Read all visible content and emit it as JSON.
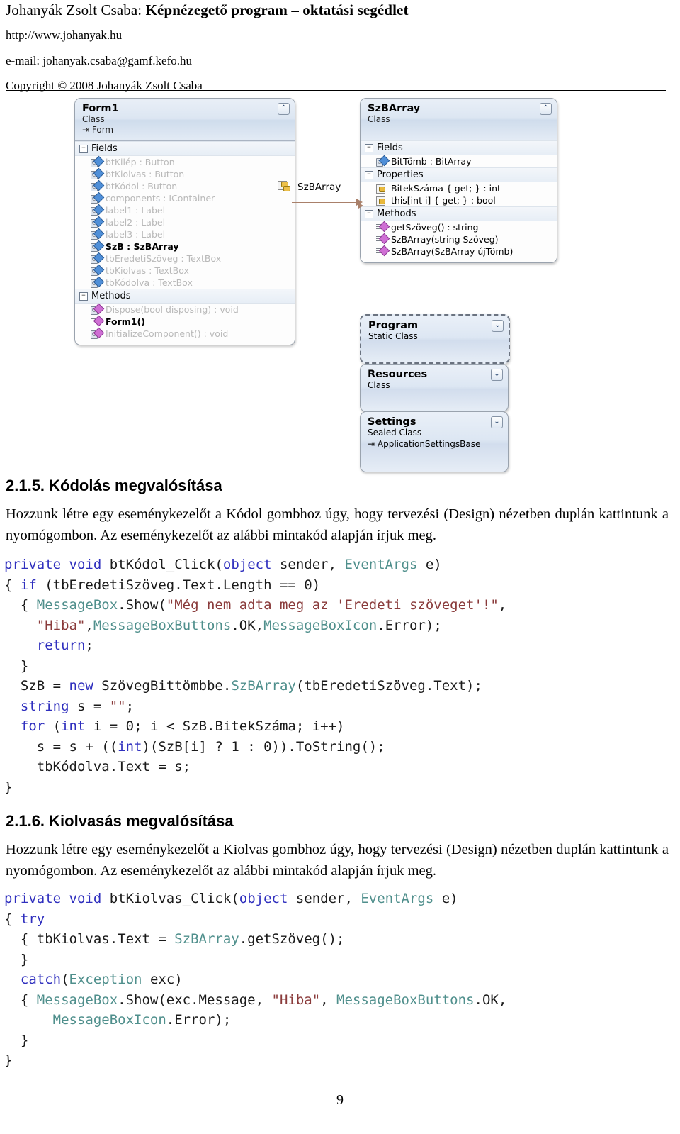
{
  "header": {
    "title_author": "Johanyák Zsolt Csaba: ",
    "title_main": "Képnézegető program – oktatási segédlet",
    "url": "http://www.johanyak.hu",
    "email": "e-mail: johanyak.csaba@gamf.kefo.hu",
    "copyright": "Copyright © 2008 Johanyák Zsolt Csaba"
  },
  "diagram": {
    "form1": {
      "name": "Form1",
      "kind": "Class",
      "base": "Form",
      "groups": [
        {
          "label": "Fields",
          "members": [
            {
              "text": "btKilép : Button",
              "icon": "field-icon",
              "style": "dim"
            },
            {
              "text": "btKiolvas : Button",
              "icon": "field-icon",
              "style": "dim"
            },
            {
              "text": "btKódol : Button",
              "icon": "field-icon",
              "style": "dim"
            },
            {
              "text": "components : IContainer",
              "icon": "field-icon",
              "style": "dim"
            },
            {
              "text": "label1 : Label",
              "icon": "field-icon",
              "style": "dim"
            },
            {
              "text": "label2 : Label",
              "icon": "field-icon",
              "style": "dim"
            },
            {
              "text": "label3 : Label",
              "icon": "field-icon",
              "style": "dim"
            },
            {
              "text": "SzB : SzBArray",
              "icon": "field-icon",
              "style": "strong"
            },
            {
              "text": "tbEredetiSzöveg : TextBox",
              "icon": "field-icon",
              "style": "dim"
            },
            {
              "text": "tbKiolvas : TextBox",
              "icon": "field-icon",
              "style": "dim"
            },
            {
              "text": "tbKódolva : TextBox",
              "icon": "field-icon",
              "style": "dim"
            }
          ]
        },
        {
          "label": "Methods",
          "members": [
            {
              "text": "Dispose(bool disposing) : void",
              "icon": "method-icon",
              "style": "dim"
            },
            {
              "text": "Form1()",
              "icon": "method-public-icon",
              "style": "strong"
            },
            {
              "text": "InitializeComponent() : void",
              "icon": "method-icon",
              "style": "dim"
            }
          ]
        }
      ]
    },
    "szbarray": {
      "name": "SzBArray",
      "kind": "Class",
      "groups": [
        {
          "label": "Fields",
          "members": [
            {
              "text": "BitTömb : BitArray",
              "icon": "field-icon",
              "style": "normal"
            }
          ]
        },
        {
          "label": "Properties",
          "members": [
            {
              "text": "BitekSzáma { get; } : int",
              "icon": "property-icon",
              "style": "normal"
            },
            {
              "text": "this[int i] { get; } : bool",
              "icon": "property-icon",
              "style": "normal"
            }
          ]
        },
        {
          "label": "Methods",
          "members": [
            {
              "text": "getSzöveg() : string",
              "icon": "method-public-icon",
              "style": "normal"
            },
            {
              "text": "SzBArray(string Szöveg)",
              "icon": "method-public-icon",
              "style": "normal"
            },
            {
              "text": "SzBArray(SzBArray újTömb)",
              "icon": "method-public-icon",
              "style": "normal"
            }
          ]
        }
      ]
    },
    "association_label": "SzBArray",
    "small_boxes": [
      {
        "name": "Program",
        "kind": "Static Class",
        "base": "",
        "dashed": true
      },
      {
        "name": "Resources",
        "kind": "Class",
        "base": "",
        "dashed": false
      },
      {
        "name": "Settings",
        "kind": "Sealed Class",
        "base": "ApplicationSettingsBase",
        "dashed": false
      }
    ],
    "collapse_glyph": "«",
    "expand_glyph": "»",
    "minus_glyph": "−"
  },
  "sections": [
    {
      "heading": "2.1.5. Kódolás megvalósítása",
      "paragraph": "Hozzunk létre egy eseménykezelőt a Kódol gombhoz úgy, hogy tervezési (Design) nézetben duplán kattintunk a nyomógombon. Az eseménykezelőt az alábbi mintakód alapján írjuk meg.",
      "code_lines": [
        [
          {
            "t": "private void ",
            "c": "kw"
          },
          {
            "t": "btKódol_Click(",
            "c": ""
          },
          {
            "t": "object",
            "c": "kw"
          },
          {
            "t": " sender, ",
            "c": ""
          },
          {
            "t": "EventArgs",
            "c": "ty"
          },
          {
            "t": " e)",
            "c": ""
          }
        ],
        [
          {
            "t": "{ ",
            "c": ""
          },
          {
            "t": "if",
            "c": "kw"
          },
          {
            "t": " (tbEredetiSzöveg.Text.Length == 0)",
            "c": ""
          }
        ],
        [
          {
            "t": "  { ",
            "c": ""
          },
          {
            "t": "MessageBox",
            "c": "ty"
          },
          {
            "t": ".Show(",
            "c": ""
          },
          {
            "t": "\"Még nem adta meg az 'Eredeti szöveget'!\"",
            "c": "st"
          },
          {
            "t": ",",
            "c": ""
          }
        ],
        [
          {
            "t": "    ",
            "c": ""
          },
          {
            "t": "\"Hiba\"",
            "c": "st"
          },
          {
            "t": ",",
            "c": ""
          },
          {
            "t": "MessageBoxButtons",
            "c": "ty"
          },
          {
            "t": ".OK,",
            "c": ""
          },
          {
            "t": "MessageBoxIcon",
            "c": "ty"
          },
          {
            "t": ".Error);",
            "c": ""
          }
        ],
        [
          {
            "t": "    ",
            "c": ""
          },
          {
            "t": "return",
            "c": "kw"
          },
          {
            "t": ";",
            "c": ""
          }
        ],
        [
          {
            "t": "  }",
            "c": ""
          }
        ],
        [
          {
            "t": "  SzB = ",
            "c": ""
          },
          {
            "t": "new",
            "c": "kw"
          },
          {
            "t": " SzövegBittömbbe.",
            "c": ""
          },
          {
            "t": "SzBArray",
            "c": "ty"
          },
          {
            "t": "(tbEredetiSzöveg.Text);",
            "c": ""
          }
        ],
        [
          {
            "t": "  ",
            "c": ""
          },
          {
            "t": "string",
            "c": "kw"
          },
          {
            "t": " s = ",
            "c": ""
          },
          {
            "t": "\"\"",
            "c": "st"
          },
          {
            "t": ";",
            "c": ""
          }
        ],
        [
          {
            "t": "  ",
            "c": ""
          },
          {
            "t": "for",
            "c": "kw"
          },
          {
            "t": " (",
            "c": ""
          },
          {
            "t": "int",
            "c": "kw"
          },
          {
            "t": " i = 0; i < SzB.BitekSzáma; i++)",
            "c": ""
          }
        ],
        [
          {
            "t": "    s = s + ((",
            "c": ""
          },
          {
            "t": "int",
            "c": "kw"
          },
          {
            "t": ")(SzB[i] ? 1 : 0)).ToString();",
            "c": ""
          }
        ],
        [
          {
            "t": "    tbKódolva.Text = s;",
            "c": ""
          }
        ],
        [
          {
            "t": "}",
            "c": ""
          }
        ]
      ]
    },
    {
      "heading": "2.1.6. Kiolvasás megvalósítása",
      "paragraph": "Hozzunk létre egy eseménykezelőt a Kiolvas gombhoz úgy, hogy tervezési (Design) nézetben duplán kattintunk a nyomógombon. Az eseménykezelőt az alábbi mintakód alapján írjuk meg.",
      "code_lines": [
        [
          {
            "t": "private void ",
            "c": "kw"
          },
          {
            "t": "btKiolvas_Click(",
            "c": ""
          },
          {
            "t": "object",
            "c": "kw"
          },
          {
            "t": " sender, ",
            "c": ""
          },
          {
            "t": "EventArgs",
            "c": "ty"
          },
          {
            "t": " e)",
            "c": ""
          }
        ],
        [
          {
            "t": "{ ",
            "c": ""
          },
          {
            "t": "try",
            "c": "kw"
          }
        ],
        [
          {
            "t": "  { tbKiolvas.Text = ",
            "c": ""
          },
          {
            "t": "SzBArray",
            "c": "ty"
          },
          {
            "t": ".getSzöveg();",
            "c": ""
          }
        ],
        [
          {
            "t": "  }",
            "c": ""
          }
        ],
        [
          {
            "t": "  ",
            "c": ""
          },
          {
            "t": "catch",
            "c": "kw"
          },
          {
            "t": "(",
            "c": ""
          },
          {
            "t": "Exception",
            "c": "ty"
          },
          {
            "t": " exc)",
            "c": ""
          }
        ],
        [
          {
            "t": "  { ",
            "c": ""
          },
          {
            "t": "MessageBox",
            "c": "ty"
          },
          {
            "t": ".Show(exc.Message, ",
            "c": ""
          },
          {
            "t": "\"Hiba\"",
            "c": "st"
          },
          {
            "t": ", ",
            "c": ""
          },
          {
            "t": "MessageBoxButtons",
            "c": "ty"
          },
          {
            "t": ".OK,",
            "c": ""
          }
        ],
        [
          {
            "t": "      ",
            "c": ""
          },
          {
            "t": "MessageBoxIcon",
            "c": "ty"
          },
          {
            "t": ".Error);",
            "c": ""
          }
        ],
        [
          {
            "t": "  }",
            "c": ""
          }
        ],
        [
          {
            "t": "}",
            "c": ""
          }
        ]
      ]
    }
  ],
  "footer": {
    "page_number": "9"
  },
  "colors": {
    "keyword": "#2f2fbe",
    "type": "#4f8f8c",
    "string": "#8a3b3b",
    "association_arrow": "#a9806a",
    "box_header": "#dce6f2"
  }
}
